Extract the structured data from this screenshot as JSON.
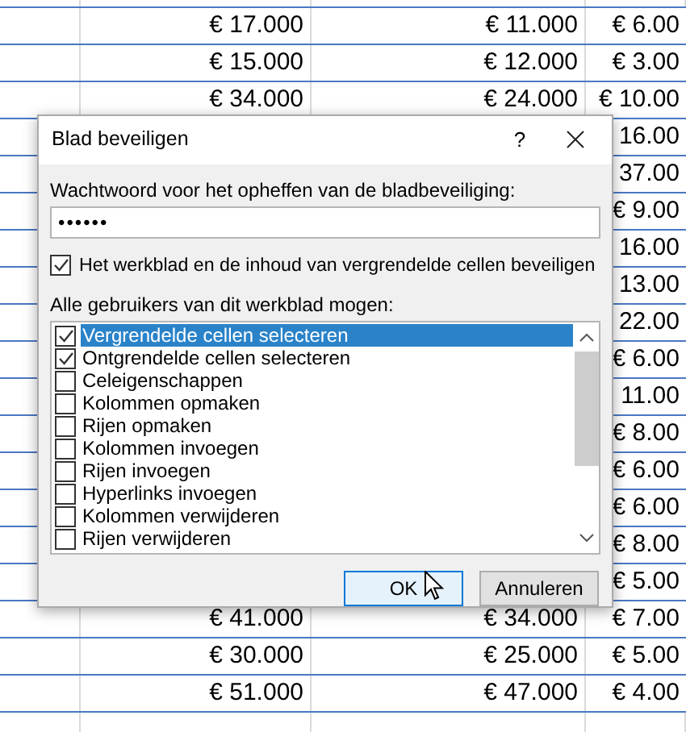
{
  "sheet": {
    "rows": [
      {
        "cells": [
          "",
          "€ 17.000",
          "€ 11.000",
          "€ 6.00"
        ]
      },
      {
        "cells": [
          "",
          "€ 15.000",
          "€ 12.000",
          "€ 3.00"
        ]
      },
      {
        "cells": [
          "",
          "€ 34.000",
          "€ 24.000",
          "€ 10.00"
        ]
      },
      {
        "cells": [
          "",
          "",
          "",
          "16.00"
        ]
      },
      {
        "cells": [
          "",
          "",
          "",
          "37.00"
        ]
      },
      {
        "cells": [
          "",
          "",
          "",
          "€ 9.00"
        ]
      },
      {
        "cells": [
          "",
          "",
          "",
          "16.00"
        ]
      },
      {
        "cells": [
          "",
          "",
          "",
          "13.00"
        ]
      },
      {
        "cells": [
          "",
          "",
          "",
          "22.00"
        ]
      },
      {
        "cells": [
          "",
          "",
          "",
          "€ 6.00"
        ]
      },
      {
        "cells": [
          "",
          "",
          "",
          "11.00"
        ]
      },
      {
        "cells": [
          "",
          "",
          "",
          "€ 8.00"
        ]
      },
      {
        "cells": [
          "",
          "",
          "",
          "€ 6.00"
        ]
      },
      {
        "cells": [
          "",
          "",
          "",
          "€ 6.00"
        ]
      },
      {
        "cells": [
          "",
          "",
          "",
          "€ 8.00"
        ]
      },
      {
        "cells": [
          "",
          "",
          "",
          "€ 5.00"
        ]
      },
      {
        "cells": [
          "",
          "€ 41.000",
          "€ 34.000",
          "€ 7.00"
        ]
      },
      {
        "cells": [
          "",
          "€ 30.000",
          "€ 25.000",
          "€ 5.00"
        ]
      },
      {
        "cells": [
          "",
          "€ 51.000",
          "€ 47.000",
          "€ 4.00"
        ]
      }
    ]
  },
  "dialog": {
    "title": "Blad beveiligen",
    "help": "?",
    "password_label": "Wachtwoord voor het opheffen van de bladbeveiliging:",
    "password_value": "••••••",
    "protect_checkbox": {
      "label": "Het werkblad en de inhoud van vergrendelde cellen beveiligen",
      "checked": true
    },
    "list_label": "Alle gebruikers van dit werkblad mogen:",
    "permissions": [
      {
        "label": "Vergrendelde cellen selecteren",
        "checked": true,
        "selected": true
      },
      {
        "label": "Ontgrendelde cellen selecteren",
        "checked": true,
        "selected": false
      },
      {
        "label": "Celeigenschappen",
        "checked": false,
        "selected": false
      },
      {
        "label": "Kolommen opmaken",
        "checked": false,
        "selected": false
      },
      {
        "label": "Rijen opmaken",
        "checked": false,
        "selected": false
      },
      {
        "label": "Kolommen invoegen",
        "checked": false,
        "selected": false
      },
      {
        "label": "Rijen invoegen",
        "checked": false,
        "selected": false
      },
      {
        "label": "Hyperlinks invoegen",
        "checked": false,
        "selected": false
      },
      {
        "label": "Kolommen verwijderen",
        "checked": false,
        "selected": false
      },
      {
        "label": "Rijen verwijderen",
        "checked": false,
        "selected": false
      }
    ],
    "buttons": [
      {
        "label": "OK",
        "kind": "primary"
      },
      {
        "label": "Annuleren",
        "kind": "secondary"
      }
    ]
  }
}
